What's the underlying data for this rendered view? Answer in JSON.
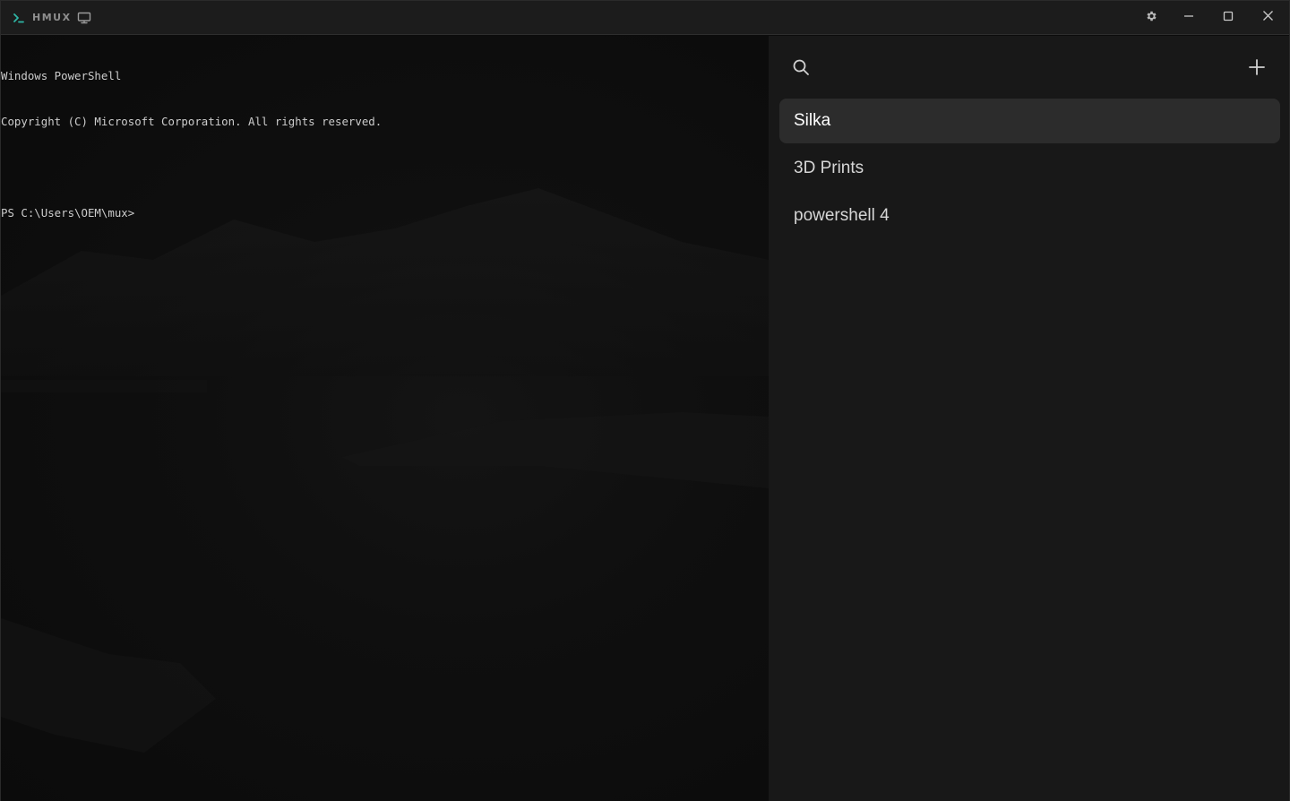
{
  "window": {
    "title": "HMUX",
    "icons": {
      "app": "terminal-prompt-icon",
      "monitor": "monitor-icon",
      "settings": "gear-icon",
      "minimize": "minimize-icon",
      "maximize": "maximize-icon",
      "close": "close-icon"
    },
    "accent": "#2fb5a5"
  },
  "terminal": {
    "lines": [
      "Windows PowerShell",
      "Copyright (C) Microsoft Corporation. All rights reserved.",
      "",
      "PS C:\\Users\\OEM\\mux>"
    ]
  },
  "sidebar": {
    "search_icon": "search-icon",
    "add_icon": "plus-icon",
    "sessions": [
      {
        "label": "Silka",
        "active": true
      },
      {
        "label": "3D Prints",
        "active": false
      },
      {
        "label": "powershell 4",
        "active": false
      }
    ]
  }
}
